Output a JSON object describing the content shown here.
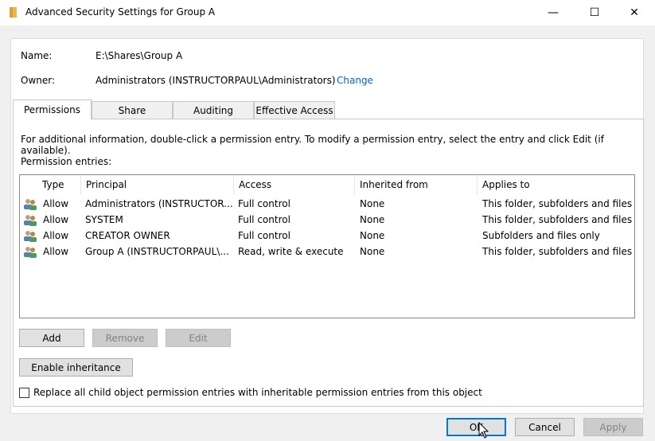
{
  "window": {
    "title": "Advanced Security Settings for Group A",
    "min_glyph": "—",
    "max_glyph": "☐",
    "close_glyph": "✕"
  },
  "fields": {
    "name_label": "Name:",
    "name_value": "E:\\Shares\\Group A",
    "owner_label": "Owner:",
    "owner_value": "Administrators (INSTRUCTORPAUL\\Administrators)",
    "owner_change_link": "Change"
  },
  "tabs": [
    "Permissions",
    "Share",
    "Auditing",
    "Effective Access"
  ],
  "permissions": {
    "info_text": "For additional information, double-click a permission entry. To modify a permission entry, select the entry and click Edit (if available).",
    "entries_label": "Permission entries:",
    "columns": [
      "Type",
      "Principal",
      "Access",
      "Inherited from",
      "Applies to"
    ],
    "rows": [
      {
        "type": "Allow",
        "principal": "Administrators (INSTRUCTOR...",
        "access": "Full control",
        "inherited": "None",
        "applies": "This folder, subfolders and files"
      },
      {
        "type": "Allow",
        "principal": "SYSTEM",
        "access": "Full control",
        "inherited": "None",
        "applies": "This folder, subfolders and files"
      },
      {
        "type": "Allow",
        "principal": "CREATOR OWNER",
        "access": "Full control",
        "inherited": "None",
        "applies": "Subfolders and files only"
      },
      {
        "type": "Allow",
        "principal": "Group A (INSTRUCTORPAUL\\...",
        "access": "Read, write & execute",
        "inherited": "None",
        "applies": "This folder, subfolders and files"
      }
    ],
    "add_label": "Add",
    "remove_label": "Remove",
    "edit_label": "Edit",
    "enable_inheritance_label": "Enable inheritance",
    "replace_checkbox_label": "Replace all child object permission entries with inheritable permission entries from this object",
    "replace_checked": false
  },
  "footer": {
    "ok_label": "OK",
    "cancel_label": "Cancel",
    "apply_label": "Apply"
  },
  "colors": {
    "link": "#0066cc",
    "accent": "#0078d7"
  }
}
